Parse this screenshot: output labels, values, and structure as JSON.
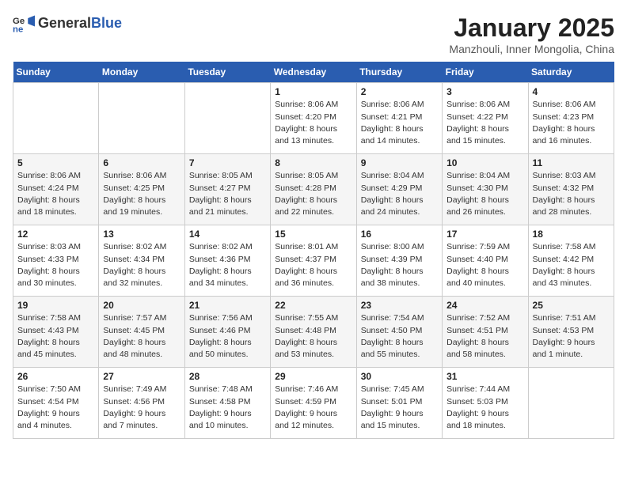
{
  "header": {
    "logo_general": "General",
    "logo_blue": "Blue",
    "month_title": "January 2025",
    "location": "Manzhouli, Inner Mongolia, China"
  },
  "weekdays": [
    "Sunday",
    "Monday",
    "Tuesday",
    "Wednesday",
    "Thursday",
    "Friday",
    "Saturday"
  ],
  "weeks": [
    [
      {
        "day": "",
        "detail": ""
      },
      {
        "day": "",
        "detail": ""
      },
      {
        "day": "",
        "detail": ""
      },
      {
        "day": "1",
        "detail": "Sunrise: 8:06 AM\nSunset: 4:20 PM\nDaylight: 8 hours\nand 13 minutes."
      },
      {
        "day": "2",
        "detail": "Sunrise: 8:06 AM\nSunset: 4:21 PM\nDaylight: 8 hours\nand 14 minutes."
      },
      {
        "day": "3",
        "detail": "Sunrise: 8:06 AM\nSunset: 4:22 PM\nDaylight: 8 hours\nand 15 minutes."
      },
      {
        "day": "4",
        "detail": "Sunrise: 8:06 AM\nSunset: 4:23 PM\nDaylight: 8 hours\nand 16 minutes."
      }
    ],
    [
      {
        "day": "5",
        "detail": "Sunrise: 8:06 AM\nSunset: 4:24 PM\nDaylight: 8 hours\nand 18 minutes."
      },
      {
        "day": "6",
        "detail": "Sunrise: 8:06 AM\nSunset: 4:25 PM\nDaylight: 8 hours\nand 19 minutes."
      },
      {
        "day": "7",
        "detail": "Sunrise: 8:05 AM\nSunset: 4:27 PM\nDaylight: 8 hours\nand 21 minutes."
      },
      {
        "day": "8",
        "detail": "Sunrise: 8:05 AM\nSunset: 4:28 PM\nDaylight: 8 hours\nand 22 minutes."
      },
      {
        "day": "9",
        "detail": "Sunrise: 8:04 AM\nSunset: 4:29 PM\nDaylight: 8 hours\nand 24 minutes."
      },
      {
        "day": "10",
        "detail": "Sunrise: 8:04 AM\nSunset: 4:30 PM\nDaylight: 8 hours\nand 26 minutes."
      },
      {
        "day": "11",
        "detail": "Sunrise: 8:03 AM\nSunset: 4:32 PM\nDaylight: 8 hours\nand 28 minutes."
      }
    ],
    [
      {
        "day": "12",
        "detail": "Sunrise: 8:03 AM\nSunset: 4:33 PM\nDaylight: 8 hours\nand 30 minutes."
      },
      {
        "day": "13",
        "detail": "Sunrise: 8:02 AM\nSunset: 4:34 PM\nDaylight: 8 hours\nand 32 minutes."
      },
      {
        "day": "14",
        "detail": "Sunrise: 8:02 AM\nSunset: 4:36 PM\nDaylight: 8 hours\nand 34 minutes."
      },
      {
        "day": "15",
        "detail": "Sunrise: 8:01 AM\nSunset: 4:37 PM\nDaylight: 8 hours\nand 36 minutes."
      },
      {
        "day": "16",
        "detail": "Sunrise: 8:00 AM\nSunset: 4:39 PM\nDaylight: 8 hours\nand 38 minutes."
      },
      {
        "day": "17",
        "detail": "Sunrise: 7:59 AM\nSunset: 4:40 PM\nDaylight: 8 hours\nand 40 minutes."
      },
      {
        "day": "18",
        "detail": "Sunrise: 7:58 AM\nSunset: 4:42 PM\nDaylight: 8 hours\nand 43 minutes."
      }
    ],
    [
      {
        "day": "19",
        "detail": "Sunrise: 7:58 AM\nSunset: 4:43 PM\nDaylight: 8 hours\nand 45 minutes."
      },
      {
        "day": "20",
        "detail": "Sunrise: 7:57 AM\nSunset: 4:45 PM\nDaylight: 8 hours\nand 48 minutes."
      },
      {
        "day": "21",
        "detail": "Sunrise: 7:56 AM\nSunset: 4:46 PM\nDaylight: 8 hours\nand 50 minutes."
      },
      {
        "day": "22",
        "detail": "Sunrise: 7:55 AM\nSunset: 4:48 PM\nDaylight: 8 hours\nand 53 minutes."
      },
      {
        "day": "23",
        "detail": "Sunrise: 7:54 AM\nSunset: 4:50 PM\nDaylight: 8 hours\nand 55 minutes."
      },
      {
        "day": "24",
        "detail": "Sunrise: 7:52 AM\nSunset: 4:51 PM\nDaylight: 8 hours\nand 58 minutes."
      },
      {
        "day": "25",
        "detail": "Sunrise: 7:51 AM\nSunset: 4:53 PM\nDaylight: 9 hours\nand 1 minute."
      }
    ],
    [
      {
        "day": "26",
        "detail": "Sunrise: 7:50 AM\nSunset: 4:54 PM\nDaylight: 9 hours\nand 4 minutes."
      },
      {
        "day": "27",
        "detail": "Sunrise: 7:49 AM\nSunset: 4:56 PM\nDaylight: 9 hours\nand 7 minutes."
      },
      {
        "day": "28",
        "detail": "Sunrise: 7:48 AM\nSunset: 4:58 PM\nDaylight: 9 hours\nand 10 minutes."
      },
      {
        "day": "29",
        "detail": "Sunrise: 7:46 AM\nSunset: 4:59 PM\nDaylight: 9 hours\nand 12 minutes."
      },
      {
        "day": "30",
        "detail": "Sunrise: 7:45 AM\nSunset: 5:01 PM\nDaylight: 9 hours\nand 15 minutes."
      },
      {
        "day": "31",
        "detail": "Sunrise: 7:44 AM\nSunset: 5:03 PM\nDaylight: 9 hours\nand 18 minutes."
      },
      {
        "day": "",
        "detail": ""
      }
    ]
  ]
}
